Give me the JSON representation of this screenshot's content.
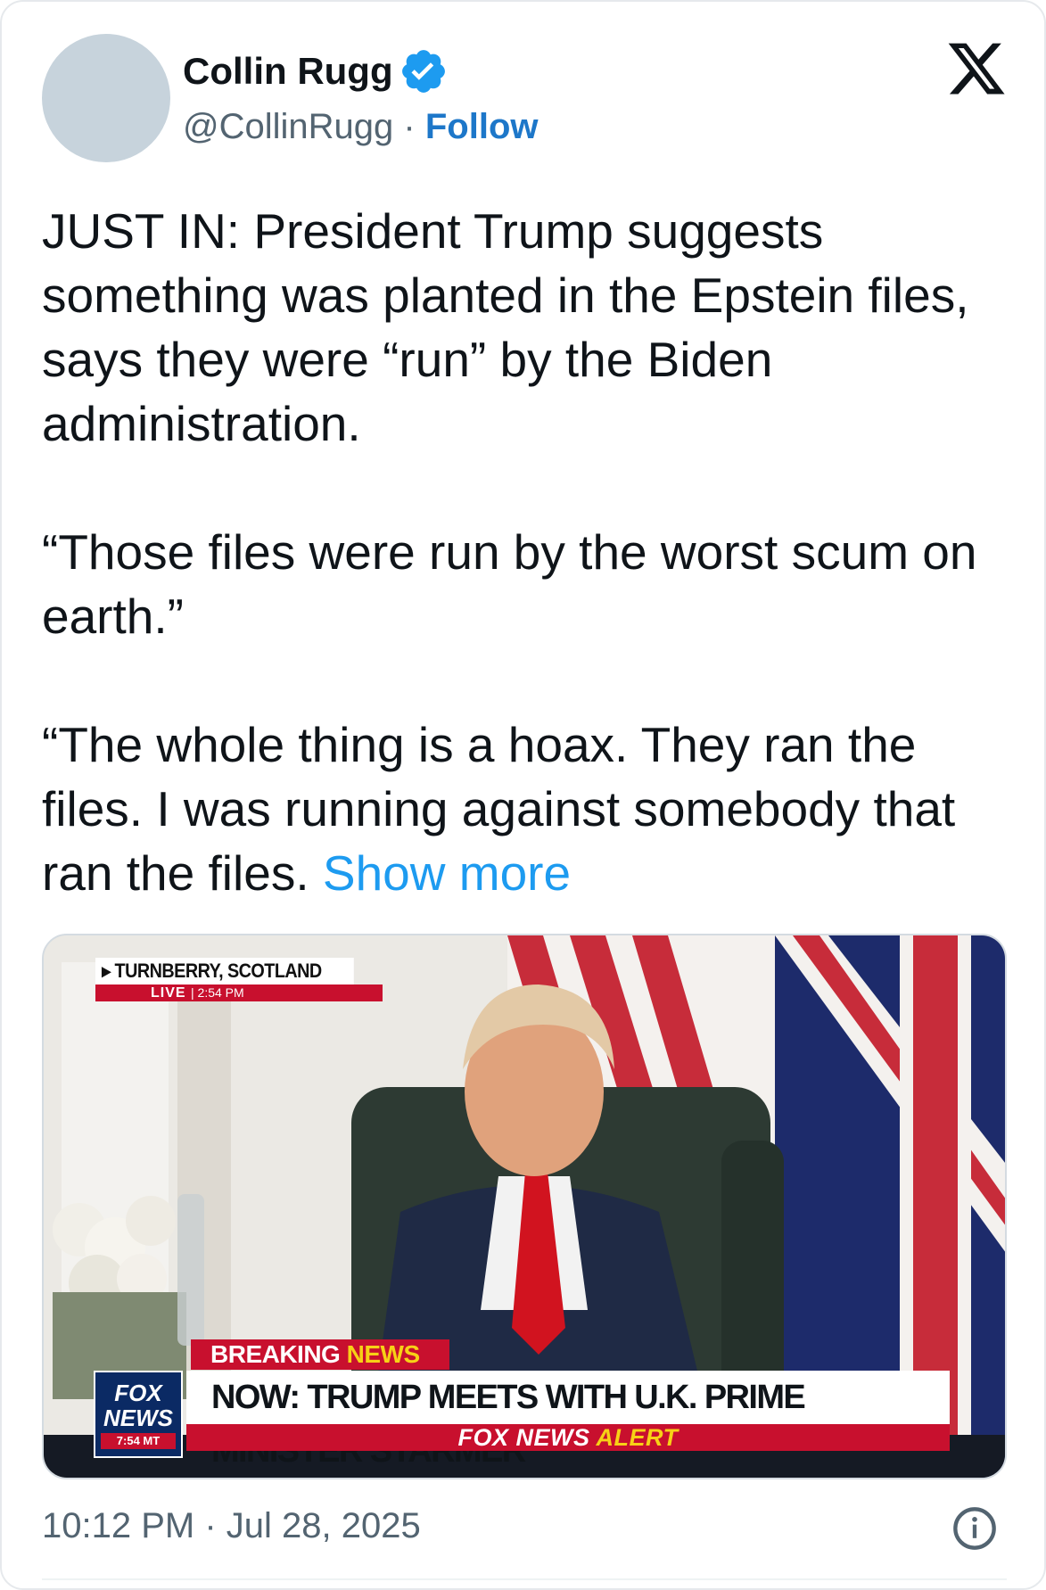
{
  "author": {
    "name": "Collin Rugg",
    "handle": "@CollinRugg",
    "separator": "·",
    "follow_label": "Follow",
    "verified_icon": "verified-badge-icon",
    "verified_color": "#1d9bf0"
  },
  "platform_icon": "x-logo-icon",
  "tweet": {
    "paragraphs": [
      "JUST IN: President Trump suggests something was planted in the Epstein files, says they were “run” by the Biden administration.",
      "“Those files were run by the worst scum on earth.”",
      "“The whole thing is a hoax. They ran the files. I was running against somebody that ran the files."
    ],
    "show_more_label": "Show more"
  },
  "media": {
    "location_label": "▸ TURNBERRY, SCOTLAND",
    "live_label": "LIVE",
    "live_time": "| 2:54 PM",
    "breaking_label": "BREAKING",
    "news_label": "NEWS",
    "fox_logo_line1": "FOX",
    "fox_logo_line2": "NEWS",
    "fox_logo_time": "7:54 MT",
    "headline": "NOW: TRUMP MEETS WITH U.K. PRIME MINISTER STARMER",
    "alert_prefix": "FOX NEWS",
    "alert_word": "ALERT"
  },
  "footer": {
    "timestamp": "10:12 PM · Jul 28, 2025",
    "info_icon": "info-icon"
  },
  "colors": {
    "link": "#1d9bf0",
    "follow": "#1d77c9",
    "secondary_text": "#536471",
    "fox_red": "#c8102e",
    "fox_navy": "#0b2a64",
    "fox_yellow": "#f7d116"
  }
}
